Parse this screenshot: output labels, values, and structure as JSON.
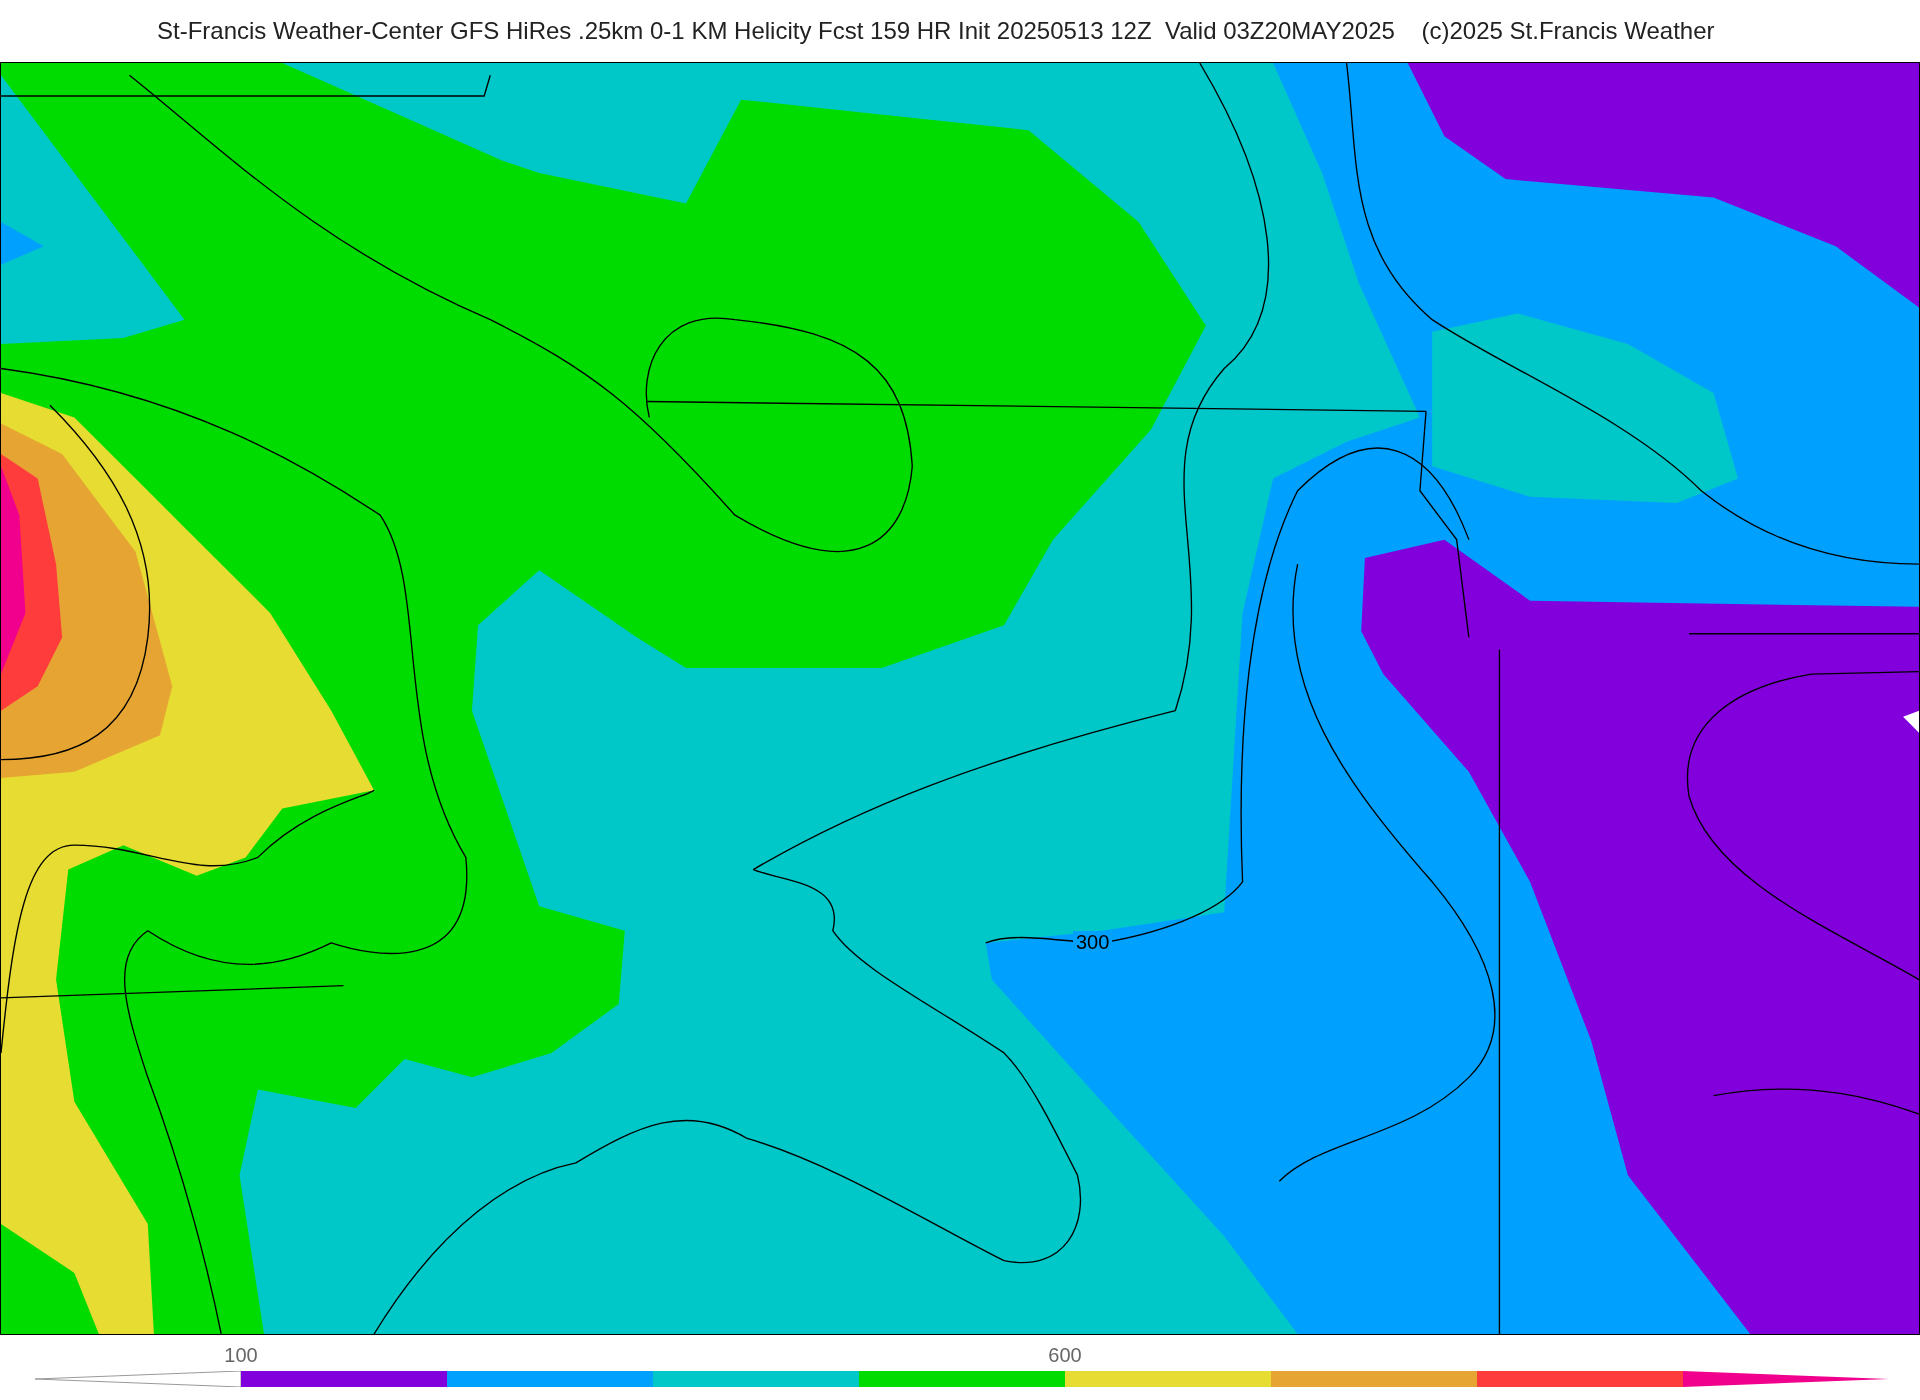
{
  "title": "St-Francis Weather-Center GFS HiRes .25km 0-1 KM Helicity Fcst 159 HR Init 20250513 12Z  Valid 03Z20MAY2025    (c)2025 St.Francis Weather",
  "map": {
    "contour_labels": [
      "300"
    ]
  },
  "colorbar": {
    "segments": [
      {
        "kind": "arrow-left",
        "color": "#ffffff"
      },
      {
        "kind": "band",
        "color": "#8200dc",
        "label": "100"
      },
      {
        "kind": "band",
        "color": "#00a0ff"
      },
      {
        "kind": "band",
        "color": "#00c8c8"
      },
      {
        "kind": "band",
        "color": "#00dc00"
      },
      {
        "kind": "band",
        "color": "#e6dc32",
        "label": "600"
      },
      {
        "kind": "band",
        "color": "#e6a532"
      },
      {
        "kind": "band",
        "color": "#ff3c3c"
      },
      {
        "kind": "arrow-right",
        "color": "#f0008c"
      }
    ]
  }
}
